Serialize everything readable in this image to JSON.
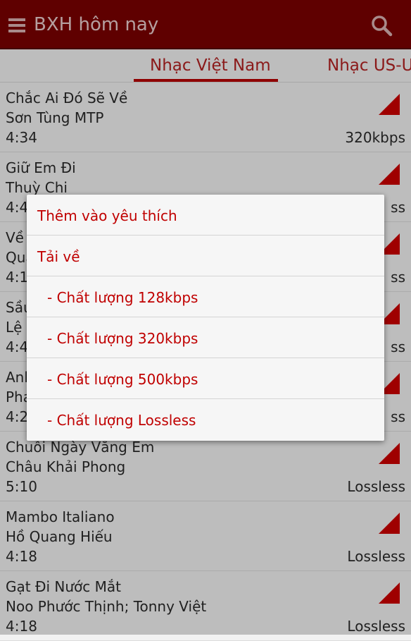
{
  "appbar": {
    "title": "BXH hôm nay",
    "menu_icon": "list-menu-icon",
    "search_icon": "search-icon"
  },
  "tabs": [
    {
      "label": "Nhạc Việt Nam",
      "selected": true
    },
    {
      "label": "Nhạc US-UK",
      "selected": false
    }
  ],
  "songs": [
    {
      "title": "Chắc Ai Đó Sẽ Về",
      "artist": "Sơn Tùng MTP",
      "duration": "4:34",
      "quality": "320kbps"
    },
    {
      "title": "Giữ Em Đi",
      "artist": "Thuỳ Chi",
      "duration": "4:4",
      "quality": "ss"
    },
    {
      "title": "Về",
      "artist": "Qua",
      "duration": "4:1",
      "quality": "ss"
    },
    {
      "title": "Sầu",
      "artist": "Lệ",
      "duration": "4:4",
      "quality": "ss"
    },
    {
      "title": "Anh",
      "artist": "Pha",
      "duration": "4:2",
      "quality": "ss"
    },
    {
      "title": "Chuỗi Ngày Vắng Em",
      "artist": "Châu Khải Phong",
      "duration": "5:10",
      "quality": "Lossless"
    },
    {
      "title": "Mambo Italiano",
      "artist": "Hồ Quang Hiếu",
      "duration": "4:18",
      "quality": "Lossless"
    },
    {
      "title": "Gạt Đi Nước Mắt",
      "artist": "Noo Phước Thịnh; Tonny Việt",
      "duration": "4:18",
      "quality": "Lossless"
    }
  ],
  "context_menu": {
    "items": [
      "Thêm vào yêu thích",
      "Tải về",
      "- Chất lượng 128kbps",
      "- Chất lượng 320kbps",
      "- Chất lượng 500kbps",
      "- Chất lượng Lossless"
    ]
  },
  "colors": {
    "appbar": "#7a0000",
    "accent": "#cc0000",
    "text": "#2a2a2a"
  }
}
